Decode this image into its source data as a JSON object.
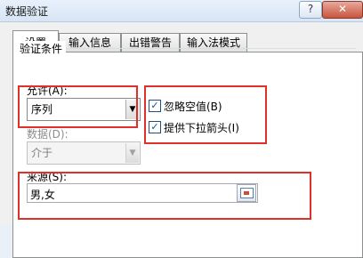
{
  "window": {
    "title": "数据验证",
    "help": "?",
    "close": "✕"
  },
  "tabs": [
    {
      "label": "设置"
    },
    {
      "label": "输入信息"
    },
    {
      "label": "出错警告"
    },
    {
      "label": "输入法模式"
    }
  ],
  "section": {
    "title": "验证条件"
  },
  "allow": {
    "label": "允许(A):",
    "value": "序列"
  },
  "data": {
    "label": "数据(D):",
    "value": "介于"
  },
  "source": {
    "label": "来源(S):",
    "value": "男,女"
  },
  "checkboxes": [
    {
      "label": "忽略空值(B)",
      "checked": true
    },
    {
      "label": "提供下拉箭头(I)",
      "checked": true
    }
  ],
  "highlight_color": "#e0302a"
}
